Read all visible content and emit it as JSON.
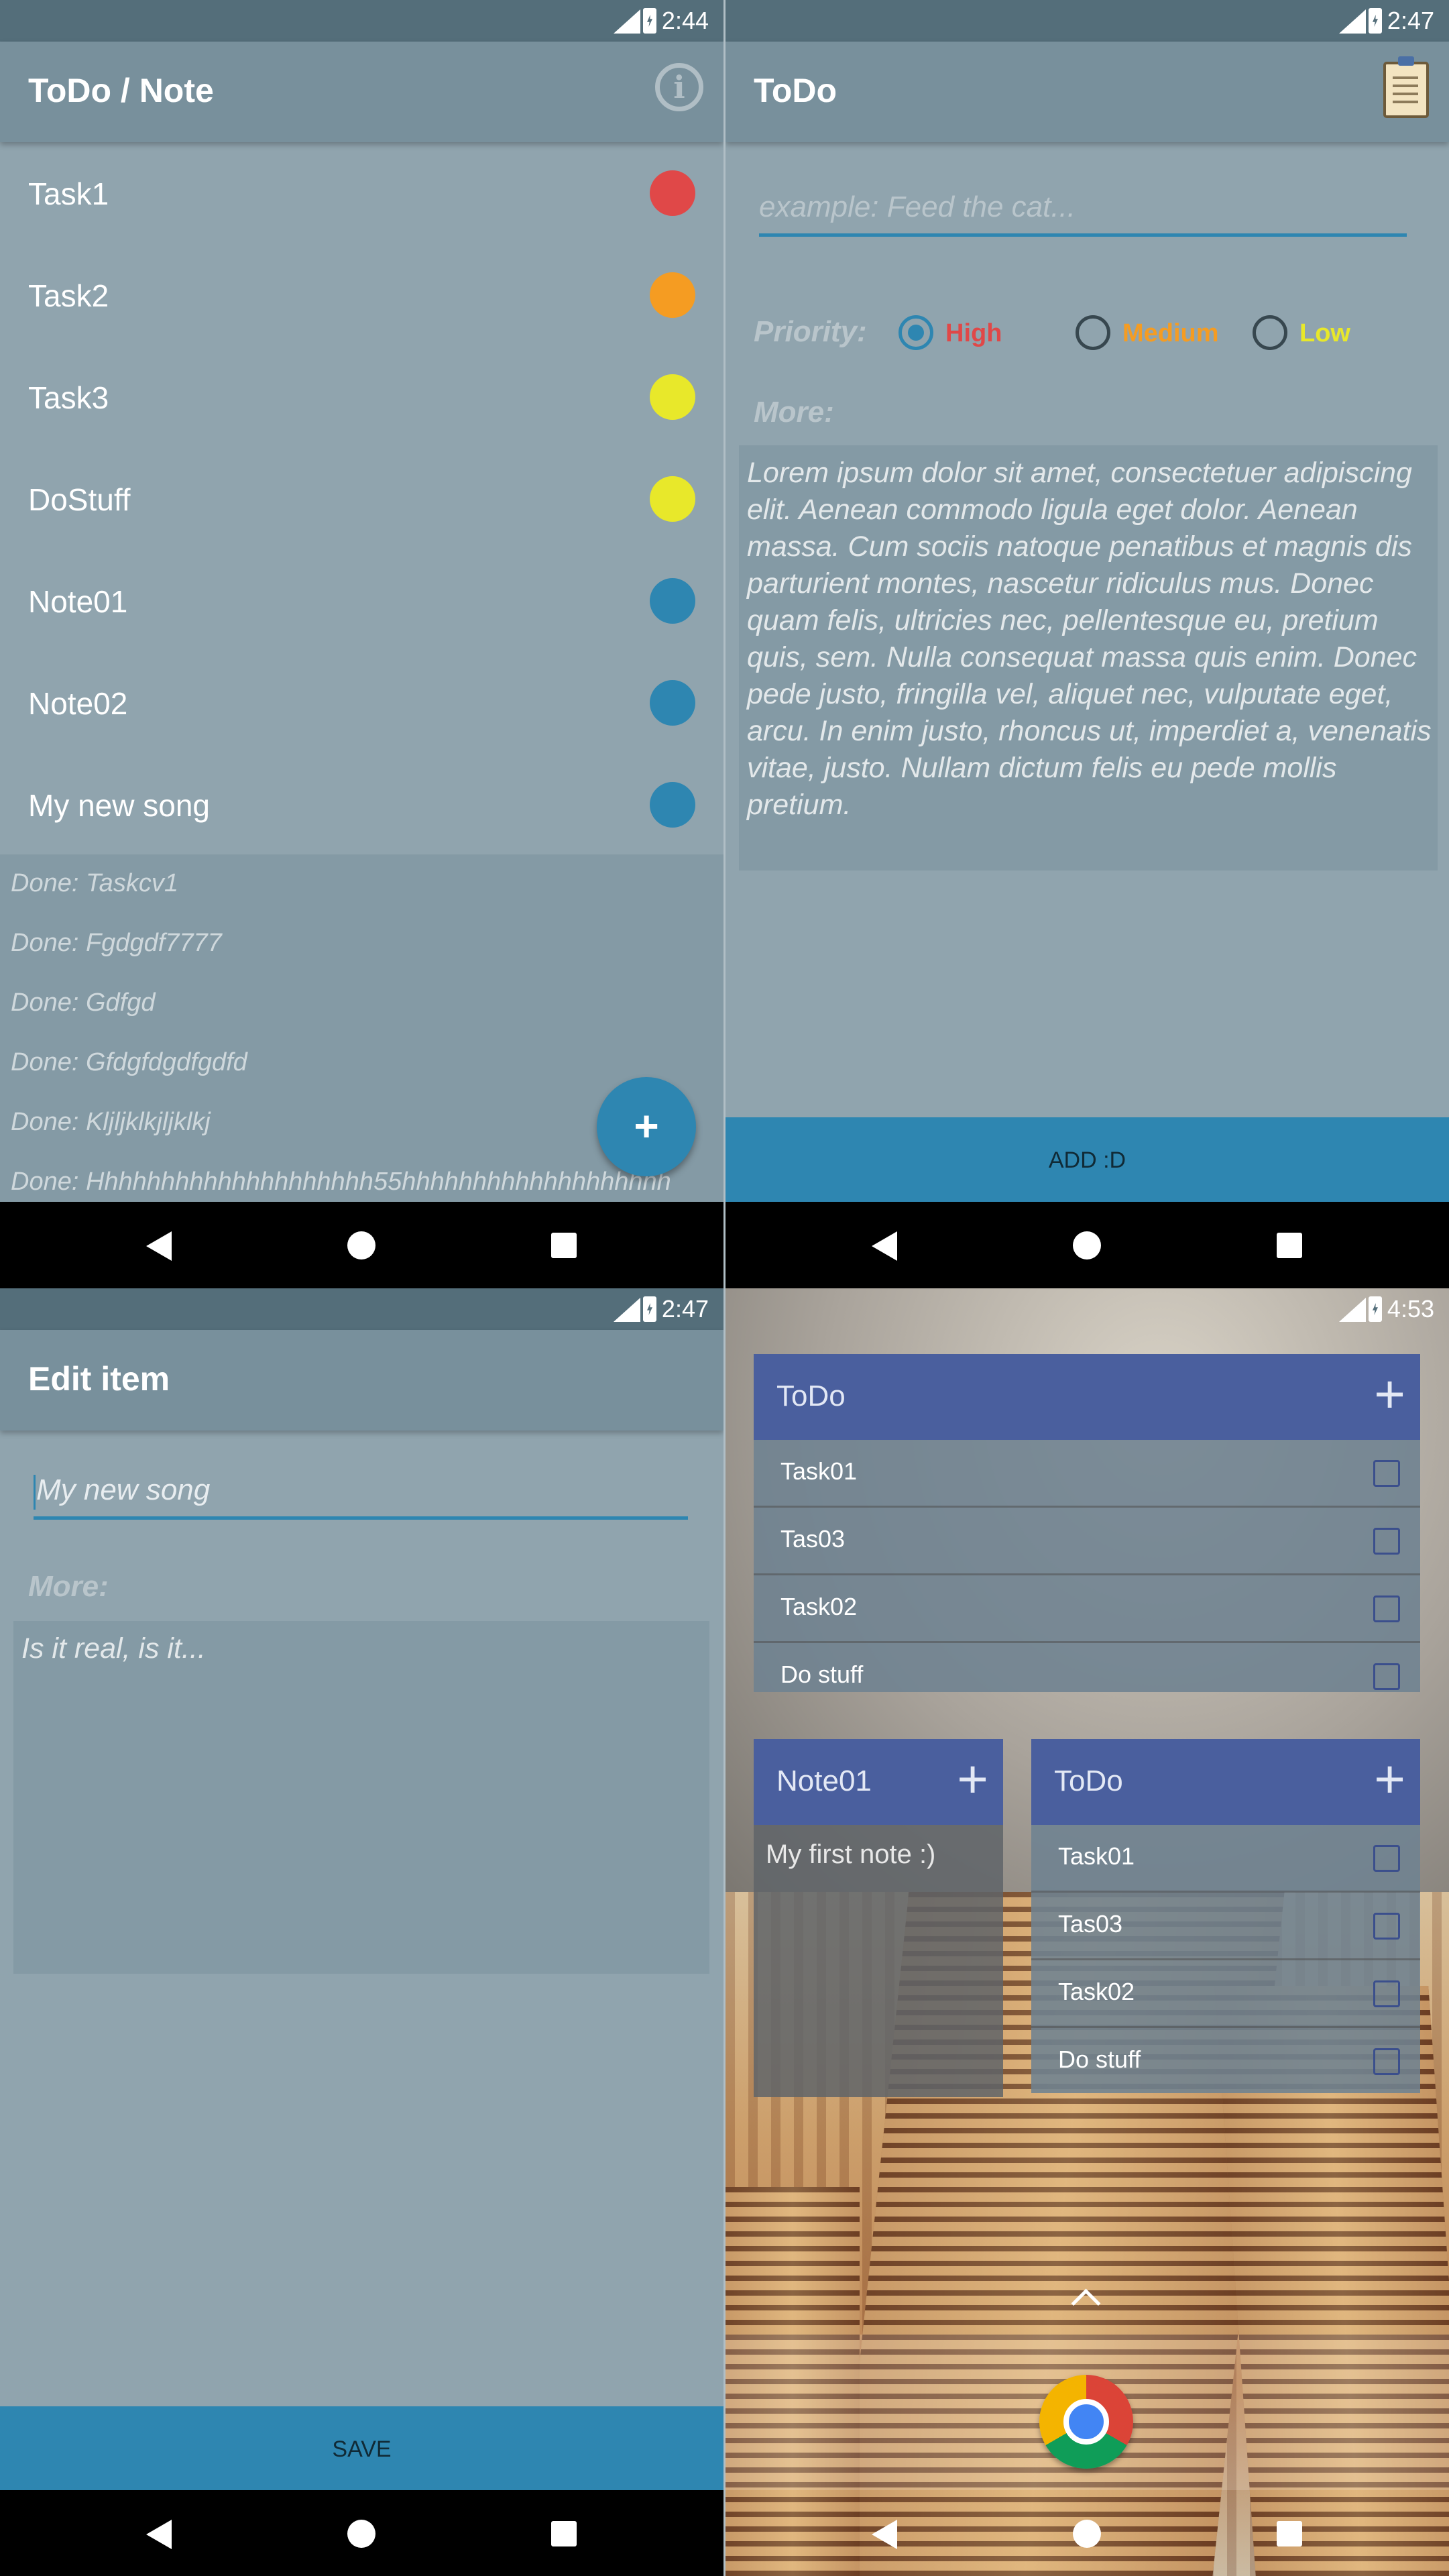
{
  "colors": {
    "background": "#90a4ae",
    "appbar": "#78909c",
    "statusbar": "#546e7a",
    "accent": "#2e86b1",
    "priority_high": "#e04848",
    "priority_medium": "#f59c22",
    "priority_low": "#e8e82a",
    "widget_header": "#4a5f9e"
  },
  "screen1": {
    "status_time": "2:44",
    "title": "ToDo / Note",
    "info_icon": "info-icon",
    "tasks": [
      {
        "label": "Task1",
        "color": "#e04848"
      },
      {
        "label": "Task2",
        "color": "#f59c22"
      },
      {
        "label": "Task3",
        "color": "#e8e82a"
      },
      {
        "label": "DoStuff",
        "color": "#e8e82a"
      },
      {
        "label": "Note01",
        "color": "#2e86b1"
      },
      {
        "label": "Note02",
        "color": "#2e86b1"
      },
      {
        "label": "My new song",
        "color": "#2e86b1"
      }
    ],
    "done": [
      "Done: Taskcv1",
      "Done: Fgdgdf7777",
      "Done: Gdfgd",
      "Done: Gfdgfdgdfgdfd",
      "Done: Kljljklkjljklkj",
      "Done: Hhhhhhhhhhhhhhhhhhhh55hhhhhhhhhhhhhhhhhhh"
    ],
    "fab_label": "+"
  },
  "screen2": {
    "status_time": "2:47",
    "title": "ToDo",
    "title_icon": "clipboard-icon",
    "input_placeholder": "example: Feed the cat...",
    "priority_label": "Priority:",
    "priorities": [
      {
        "label": "High",
        "selected": true
      },
      {
        "label": "Medium",
        "selected": false
      },
      {
        "label": "Low",
        "selected": false
      }
    ],
    "more_label": "More:",
    "more_text": "Lorem ipsum dolor sit amet, consectetuer adipiscing elit. Aenean commodo ligula eget dolor. Aenean massa. Cum sociis natoque penatibus et magnis dis parturient montes, nascetur ridiculus mus. Donec quam felis, ultricies nec, pellentesque eu, pretium quis, sem. Nulla consequat massa quis enim. Donec pede justo, fringilla vel, aliquet nec, vulputate eget, arcu. In enim justo, rhoncus ut, imperdiet a, venenatis vitae, justo. Nullam dictum felis eu pede mollis pretium.",
    "button_label": "ADD :D"
  },
  "screen3": {
    "status_time": "2:47",
    "title": "Edit item",
    "input_value": "My new song",
    "more_label": "More:",
    "more_text": "Is it real, is it...",
    "button_label": "SAVE"
  },
  "screen4": {
    "status_time": "4:53",
    "widget_large": {
      "title": "ToDo",
      "items": [
        "Task01",
        "Tas03",
        "Task02",
        "Do stuff"
      ]
    },
    "widget_note": {
      "title": "Note01",
      "text": "My first note :)"
    },
    "widget_small": {
      "title": "ToDo",
      "items": [
        "Task01",
        "Tas03",
        "Task02",
        "Do stuff"
      ]
    },
    "plus_label": "+",
    "dock_app": "chrome-icon"
  }
}
